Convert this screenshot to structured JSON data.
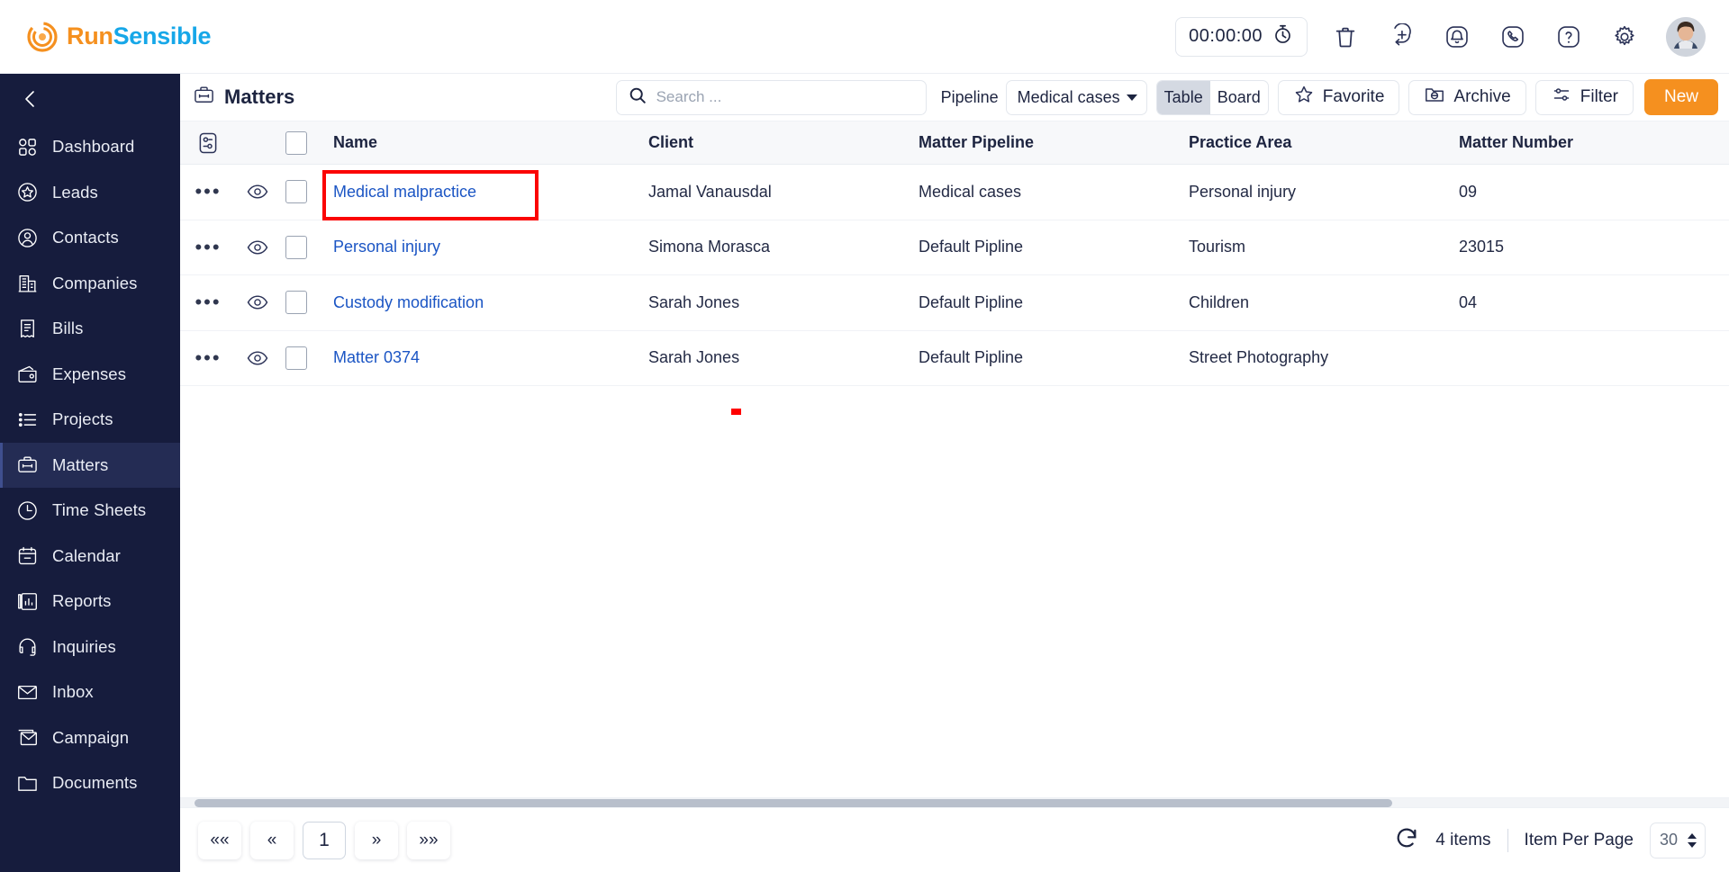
{
  "brand": {
    "part1": "Run",
    "part2": "Sensible",
    "logo_icon": "runsensible-logo-icon"
  },
  "topbar": {
    "timer": "00:00:00",
    "icons": [
      {
        "name": "timer-icon",
        "label": "stopwatch"
      },
      {
        "name": "trash-icon",
        "label": "trash"
      },
      {
        "name": "add-circle-icon",
        "label": "quick-add"
      },
      {
        "name": "notification-bell-icon",
        "label": "notifications"
      },
      {
        "name": "phone-icon",
        "label": "calls"
      },
      {
        "name": "help-icon",
        "label": "help"
      },
      {
        "name": "gear-icon",
        "label": "settings"
      },
      {
        "name": "avatar",
        "label": "user profile"
      }
    ]
  },
  "sidebar": {
    "collapse_icon": "chevron-left-icon",
    "items": [
      {
        "label": "Dashboard",
        "icon": "dashboard-icon",
        "active": false
      },
      {
        "label": "Leads",
        "icon": "star-badge-icon",
        "active": false
      },
      {
        "label": "Contacts",
        "icon": "user-circle-icon",
        "active": false
      },
      {
        "label": "Companies",
        "icon": "building-icon",
        "active": false
      },
      {
        "label": "Bills",
        "icon": "receipt-icon",
        "active": false
      },
      {
        "label": "Expenses",
        "icon": "wallet-icon",
        "active": false
      },
      {
        "label": "Projects",
        "icon": "list-icon",
        "active": false
      },
      {
        "label": "Matters",
        "icon": "briefcase-icon",
        "active": true
      },
      {
        "label": "Time Sheets",
        "icon": "clock-icon",
        "active": false
      },
      {
        "label": "Calendar",
        "icon": "calendar-icon",
        "active": false
      },
      {
        "label": "Reports",
        "icon": "report-icon",
        "active": false
      },
      {
        "label": "Inquiries",
        "icon": "headset-icon",
        "active": false
      },
      {
        "label": "Inbox",
        "icon": "envelope-icon",
        "active": false
      },
      {
        "label": "Campaign",
        "icon": "campaign-mail-icon",
        "active": false
      },
      {
        "label": "Documents",
        "icon": "folder-icon",
        "active": false
      }
    ]
  },
  "header": {
    "title": "Matters",
    "title_icon": "briefcase-icon",
    "search_placeholder": "Search ...",
    "search_value": "",
    "search_icon": "search-icon",
    "pipeline_label": "Pipeline",
    "pipeline_value": "Medical cases",
    "view_table": "Table",
    "view_board": "Board",
    "view_selected": "Table",
    "favorite_label": "Favorite",
    "favorite_icon": "star-icon",
    "archive_label": "Archive",
    "archive_icon": "archive-icon",
    "filter_label": "Filter",
    "filter_icon": "filter-icon",
    "new_label": "New",
    "new_color": "#f5901f"
  },
  "table": {
    "settings_icon": "column-settings-icon",
    "columns": [
      "Name",
      "Client",
      "Matter Pipeline",
      "Practice Area",
      "Matter Number"
    ],
    "rows": [
      {
        "name": "Medical malpractice",
        "client": "Jamal Vanausdal",
        "pipeline": "Medical cases",
        "practice": "Personal injury",
        "number": "09",
        "highlighted": true
      },
      {
        "name": "Personal injury",
        "client": "Simona Morasca",
        "pipeline": "Default Pipline",
        "practice": "Tourism",
        "number": "23015",
        "highlighted": false
      },
      {
        "name": "Custody modification",
        "client": "Sarah Jones",
        "pipeline": "Default Pipline",
        "practice": "Children",
        "number": "04",
        "highlighted": false
      },
      {
        "name": "Matter 0374",
        "client": "Sarah Jones",
        "pipeline": "Default Pipline",
        "practice": "Street Photography",
        "number": "",
        "highlighted": false
      }
    ],
    "row_menu_icon": "more-options-icon",
    "row_preview_icon": "eye-icon",
    "highlight_color": "#fb0404",
    "link_color": "#1b55c4"
  },
  "footer": {
    "first_label": "««",
    "prev_label": "«",
    "current_page": "1",
    "next_label": "»",
    "last_label": "»»",
    "refresh_icon": "refresh-icon",
    "item_count": "4 items",
    "per_page_label": "Item Per Page",
    "per_page_value": "30"
  }
}
